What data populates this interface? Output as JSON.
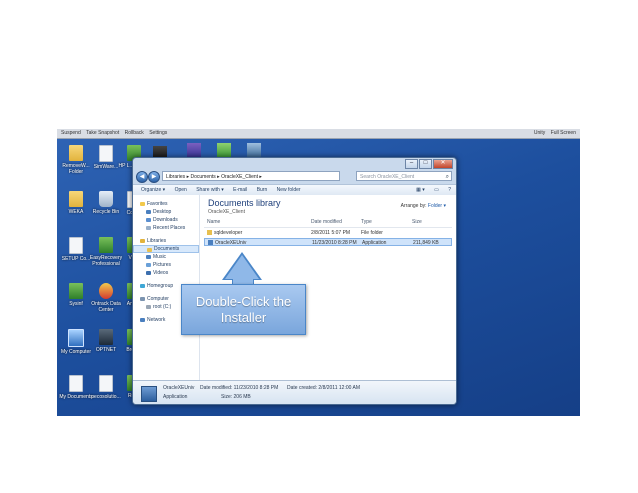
{
  "vm_toolbar": {
    "items": [
      "Suspend",
      "Take Snapshot",
      "Rollback",
      "Settings"
    ],
    "right_items": [
      "Unity",
      "Full Screen"
    ]
  },
  "desktop_icons": [
    {
      "label": "RemoveW... Folder",
      "icon": "folder-icon"
    },
    {
      "label": "SimWare...",
      "icon": "doc-icon"
    },
    {
      "label": "HP L... Shar...",
      "icon": "app-icon"
    },
    {
      "label": "WEKA",
      "icon": "folder-icon"
    },
    {
      "label": "Recycle Bin",
      "icon": "recycle-bin-icon"
    },
    {
      "label": "Com...",
      "icon": "doc-icon"
    },
    {
      "label": "SETUP Co...",
      "icon": "doc-icon"
    },
    {
      "label": "EasyRecovery Professional",
      "icon": "app-icon"
    },
    {
      "label": "VC...",
      "icon": "app-icon"
    },
    {
      "label": "Sysinf",
      "icon": "app-icon"
    },
    {
      "label": "Ontrack Data Center",
      "icon": "red-app-icon"
    },
    {
      "label": "Andr...",
      "icon": "app-icon"
    },
    {
      "label": "My Computer",
      "icon": "computer-icon"
    },
    {
      "label": "OPTNET",
      "icon": "dark-app-icon"
    },
    {
      "label": "Brow...",
      "icon": "app-icon"
    },
    {
      "label": "My Documents",
      "icon": "doc-icon"
    },
    {
      "label": "pecosolutio...",
      "icon": "doc-icon"
    },
    {
      "label": "Ret...",
      "icon": "app-icon"
    }
  ],
  "explorer": {
    "address": [
      "Libraries",
      "Documents",
      "OracleXE_Client"
    ],
    "search_placeholder": "Search OracleXE_Client",
    "toolbar": [
      "Organize ▾",
      "Open",
      "Share with ▾",
      "E-mail",
      "Burn",
      "New folder"
    ],
    "nav": {
      "favorites_label": "Favorites",
      "favorites": [
        "Desktop",
        "Downloads",
        "Recent Places"
      ],
      "libraries_label": "Libraries",
      "libraries": [
        "Documents",
        "Music",
        "Pictures",
        "Videos"
      ],
      "homegroup": "Homegroup",
      "computer_label": "Computer",
      "computer": [
        "root (C:)"
      ],
      "network": "Network"
    },
    "library_title": "Documents library",
    "library_subtitle": "OracleXE_Client",
    "arrange_label": "Arrange by:",
    "arrange_value": "Folder ▾",
    "columns": {
      "name": "Name",
      "date": "Date modified",
      "type": "Type",
      "size": "Size"
    },
    "files": [
      {
        "name": "sqldeveloper",
        "date": "2/8/2011 5:07 PM",
        "type": "File folder",
        "size": "",
        "icon": "folder-icon"
      },
      {
        "name": "OracleXEUniv",
        "date": "11/23/2010 8:28 PM",
        "type": "Application",
        "size": "211,849 KB",
        "icon": "application-icon"
      }
    ],
    "details": {
      "name": "OracleXEUniv",
      "modified": "Date modified: 11/23/2010 8:28 PM",
      "created": "Date created: 2/8/2011 12:00 AM",
      "type": "Application",
      "size": "Size: 206 MB"
    }
  },
  "callout": {
    "text": "Double-Click the Installer"
  }
}
